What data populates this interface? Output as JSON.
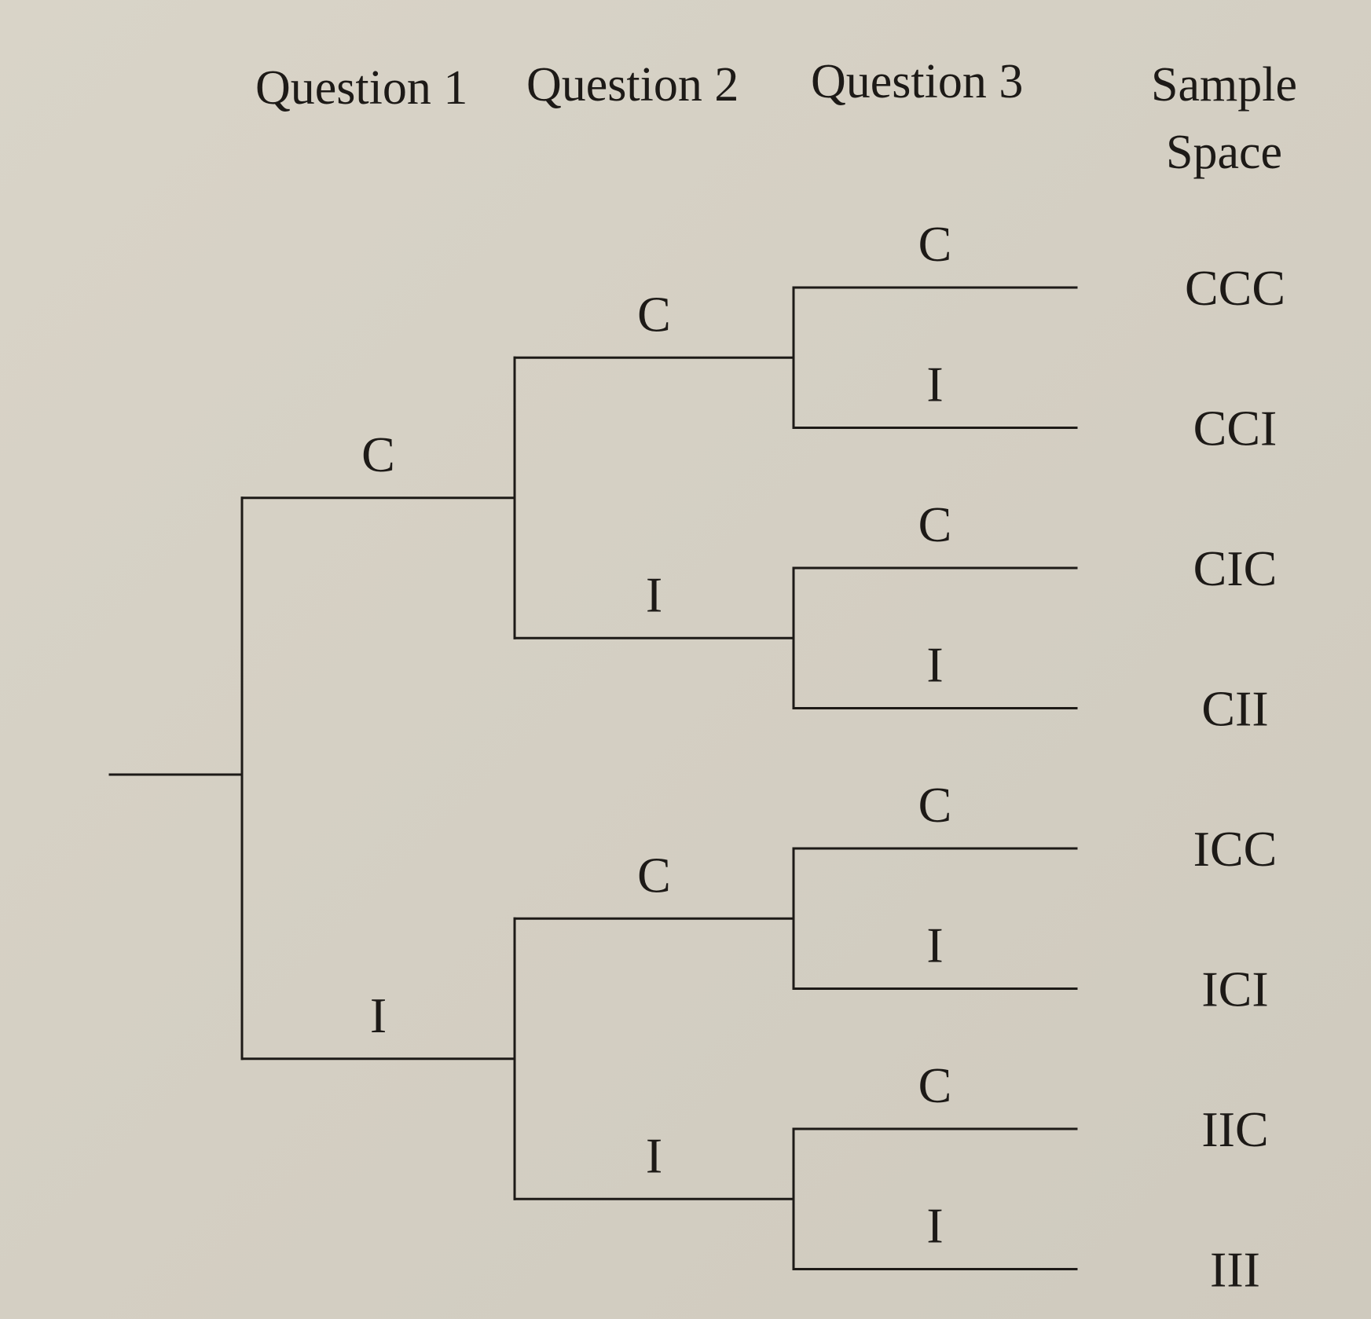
{
  "headers": {
    "question_1": "Question 1",
    "question_2": "Question 2",
    "question_3": "Question 3",
    "sample_space_line1": "Sample",
    "sample_space_line2": "Space"
  },
  "tree": {
    "label": "",
    "children": [
      {
        "label": "C",
        "children": [
          {
            "label": "C",
            "children": [
              {
                "label": "C",
                "outcome": "CCC"
              },
              {
                "label": "I",
                "outcome": "CCI"
              }
            ]
          },
          {
            "label": "I",
            "children": [
              {
                "label": "C",
                "outcome": "CIC"
              },
              {
                "label": "I",
                "outcome": "CII"
              }
            ]
          }
        ]
      },
      {
        "label": "I",
        "children": [
          {
            "label": "C",
            "children": [
              {
                "label": "C",
                "outcome": "ICC"
              },
              {
                "label": "I",
                "outcome": "ICI"
              }
            ]
          },
          {
            "label": "I",
            "children": [
              {
                "label": "C",
                "outcome": "IIC"
              },
              {
                "label": "I",
                "outcome": "III"
              }
            ]
          }
        ]
      }
    ]
  }
}
